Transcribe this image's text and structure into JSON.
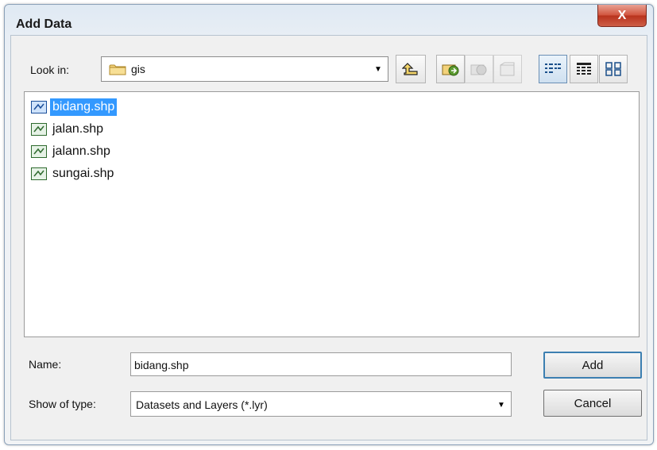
{
  "window": {
    "title": "Add Data",
    "close_label": "X"
  },
  "look_in": {
    "label": "Look in:",
    "value": "gis"
  },
  "toolbar": {
    "up_icon": "up-one-level-icon",
    "connect_icon": "connect-to-folder-icon",
    "disconnect_icon": "disconnect-folder-icon",
    "new_folder_icon": "new-folder-icon",
    "list_view_icon": "list-view-icon",
    "details_view_icon": "details-view-icon",
    "thumbnails_view_icon": "thumbnails-view-icon"
  },
  "files": [
    {
      "name": "bidang.shp",
      "selected": true
    },
    {
      "name": "jalan.shp",
      "selected": false
    },
    {
      "name": "jalann.shp",
      "selected": false
    },
    {
      "name": "sungai.shp",
      "selected": false
    }
  ],
  "name_field": {
    "label": "Name:",
    "value": "bidang.shp"
  },
  "type_field": {
    "label": "Show of type:",
    "value": "Datasets and Layers (*.lyr)"
  },
  "buttons": {
    "add": "Add",
    "cancel": "Cancel"
  },
  "colors": {
    "selection": "#3399ff",
    "close": "#c9432b"
  }
}
